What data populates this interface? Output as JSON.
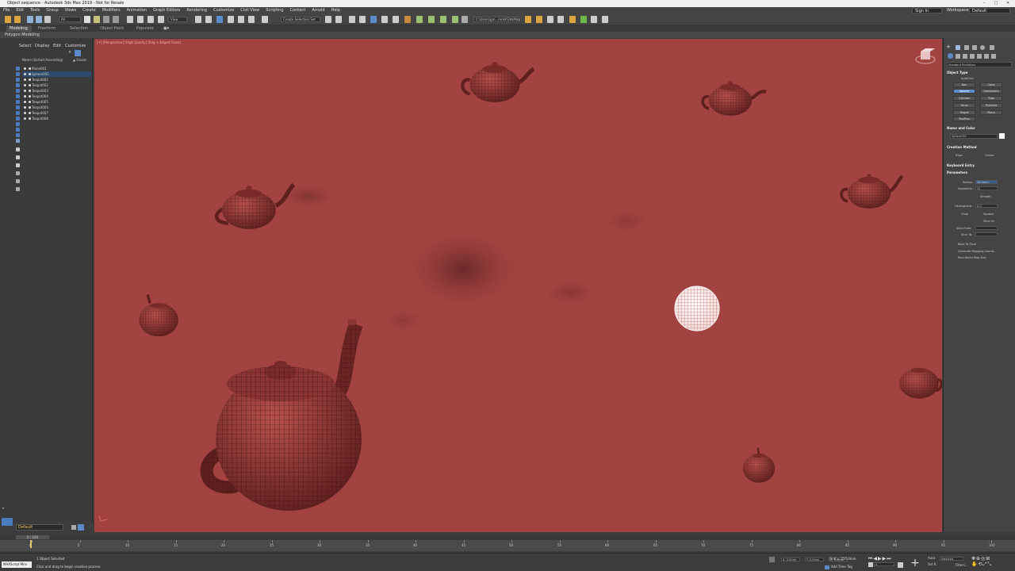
{
  "window": {
    "title": "Object sequence - Autodesk 3ds Max 2019 - Not for Resale",
    "controls": [
      "–",
      "□",
      "✕"
    ]
  },
  "menu": {
    "items": [
      "File",
      "Edit",
      "Tools",
      "Group",
      "Views",
      "Create",
      "Modifiers",
      "Animation",
      "Graph Editors",
      "Rendering",
      "Customize",
      "Civil View",
      "Scripting",
      "Content",
      "Arnold",
      "Help"
    ],
    "signin": "Sign In",
    "workspaces_label": "Workspaces:",
    "workspace_value": "Default"
  },
  "toolbar": {
    "filter_dropdown": "All",
    "view_dropdown": "View",
    "selection_set": "Create Selection Set",
    "path_field": "C:\\Users\\gm...mrkit\\3dsMax"
  },
  "ribbon": {
    "tabs": [
      "Modeling",
      "Freeform",
      "Selection",
      "Object Paint",
      "Populate"
    ],
    "active_tab": "Modeling",
    "row_label": "Polygon Modeling"
  },
  "scene_explorer": {
    "menu": [
      "Select",
      "Display",
      "Edit",
      "Customize"
    ],
    "column_name": "Name (Sorted Ascending)",
    "column_frozen": "▲ Frozen",
    "rows": [
      {
        "name": "Plane001",
        "selected": false
      },
      {
        "name": "Sphere001",
        "selected": true
      },
      {
        "name": "Teapot001",
        "selected": false
      },
      {
        "name": "Teapot002",
        "selected": false
      },
      {
        "name": "Teapot003",
        "selected": false
      },
      {
        "name": "Teapot004",
        "selected": false
      },
      {
        "name": "Teapot005",
        "selected": false
      },
      {
        "name": "Teapot006",
        "selected": false
      },
      {
        "name": "Teapot007",
        "selected": false
      },
      {
        "name": "Teapot008",
        "selected": false
      }
    ],
    "layer": "Default"
  },
  "viewport": {
    "label": "[+] [Perspective] [High Quality] [Edg + Edged Faces]",
    "background": "#a34341"
  },
  "command_panel": {
    "category_dropdown": "Standard Primitives",
    "object_type_title": "Object Type",
    "autogrid": "AutoGrid",
    "buttons": [
      "Box",
      "Cone",
      "Sphere",
      "GeoSphere",
      "Cylinder",
      "Tube",
      "Torus",
      "Pyramid",
      "Teapot",
      "Plane",
      "TextPlus"
    ],
    "active_button": "Sphere",
    "name_color_title": "Name and Color",
    "object_name": "Sphere001",
    "creation_method_title": "Creation Method",
    "creation_edge": "Edge",
    "creation_center": "Center",
    "keyboard_entry_title": "Keyboard Entry",
    "parameters_title": "Parameters",
    "radius_label": "Radius:",
    "radius_value": "28.4mm",
    "segments_label": "Segments:",
    "segments_value": "32",
    "smooth": "Smooth",
    "hemisphere_label": "Hemisphere:",
    "hemisphere_value": "0.0",
    "chop": "Chop",
    "squash": "Squash",
    "slice_on": "Slice On",
    "slice_from_label": "Slice From:",
    "slice_to_label": "Slice To:",
    "base_to_pivot": "Base To Pivot",
    "gen_mapping": "Generate Mapping Coords.",
    "real_world": "Real-World Map Size"
  },
  "timeline": {
    "frame_display": "0 / 100",
    "ticks": [
      "0",
      "5",
      "10",
      "15",
      "20",
      "25",
      "30",
      "35",
      "40",
      "45",
      "50",
      "55",
      "60",
      "65",
      "70",
      "75",
      "80",
      "85",
      "90",
      "95",
      "100"
    ]
  },
  "status": {
    "maxscript": "MAXScript Mini",
    "selected_count": "1 Object Selected",
    "prompt": "Click and drag to begin creation process",
    "coord_x": "X: 0.0mm",
    "coord_y": "Y: 0.0mm",
    "coord_z": "Z: 0.0mm",
    "grid": "Grid = 254.0mm",
    "add_time_tag": "Add Time Tag",
    "auto_key": "Auto",
    "set_key": "Set K.",
    "selected_dd": "Selected",
    "filters": "Filters...",
    "frame": "0"
  }
}
